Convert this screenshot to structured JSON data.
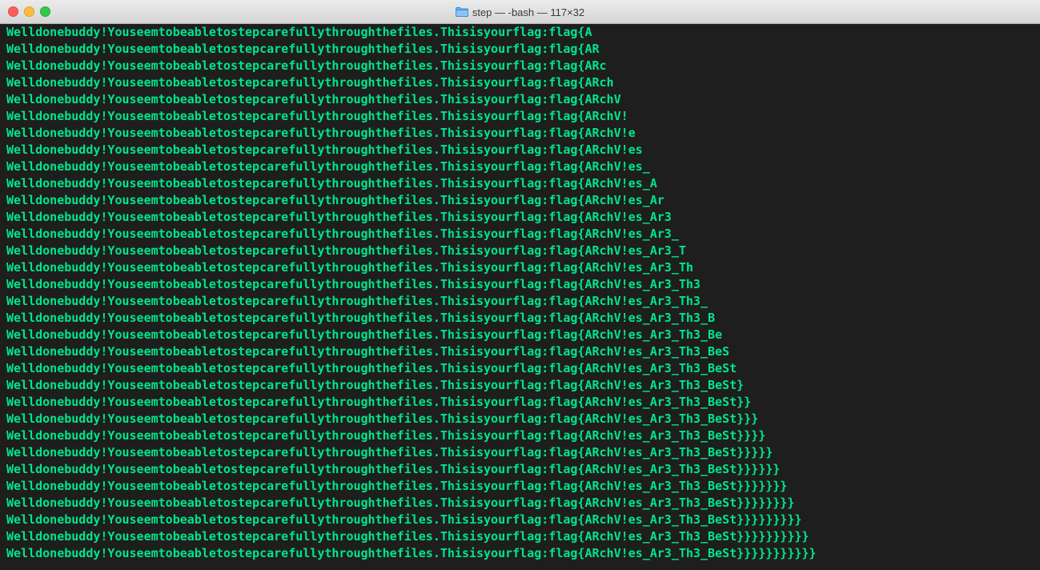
{
  "window": {
    "title": "step — -bash — 117×32"
  },
  "colors": {
    "terminal_background": "#1e1e1e",
    "terminal_text": "#00e58c",
    "close": "#fc605c",
    "minimize": "#fdbc40",
    "maximize": "#34c84a"
  },
  "icons": {
    "title": "folder-icon"
  },
  "terminal": {
    "lines": [
      "Welldonebuddy!Youseemtobeabletostepcarefullythroughthefiles.Thisisyourflag:flag{A",
      "Welldonebuddy!Youseemtobeabletostepcarefullythroughthefiles.Thisisyourflag:flag{AR",
      "Welldonebuddy!Youseemtobeabletostepcarefullythroughthefiles.Thisisyourflag:flag{ARc",
      "Welldonebuddy!Youseemtobeabletostepcarefullythroughthefiles.Thisisyourflag:flag{ARch",
      "Welldonebuddy!Youseemtobeabletostepcarefullythroughthefiles.Thisisyourflag:flag{ARchV",
      "Welldonebuddy!Youseemtobeabletostepcarefullythroughthefiles.Thisisyourflag:flag{ARchV!",
      "Welldonebuddy!Youseemtobeabletostepcarefullythroughthefiles.Thisisyourflag:flag{ARchV!e",
      "Welldonebuddy!Youseemtobeabletostepcarefullythroughthefiles.Thisisyourflag:flag{ARchV!es",
      "Welldonebuddy!Youseemtobeabletostepcarefullythroughthefiles.Thisisyourflag:flag{ARchV!es_",
      "Welldonebuddy!Youseemtobeabletostepcarefullythroughthefiles.Thisisyourflag:flag{ARchV!es_A",
      "Welldonebuddy!Youseemtobeabletostepcarefullythroughthefiles.Thisisyourflag:flag{ARchV!es_Ar",
      "Welldonebuddy!Youseemtobeabletostepcarefullythroughthefiles.Thisisyourflag:flag{ARchV!es_Ar3",
      "Welldonebuddy!Youseemtobeabletostepcarefullythroughthefiles.Thisisyourflag:flag{ARchV!es_Ar3_",
      "Welldonebuddy!Youseemtobeabletostepcarefullythroughthefiles.Thisisyourflag:flag{ARchV!es_Ar3_T",
      "Welldonebuddy!Youseemtobeabletostepcarefullythroughthefiles.Thisisyourflag:flag{ARchV!es_Ar3_Th",
      "Welldonebuddy!Youseemtobeabletostepcarefullythroughthefiles.Thisisyourflag:flag{ARchV!es_Ar3_Th3",
      "Welldonebuddy!Youseemtobeabletostepcarefullythroughthefiles.Thisisyourflag:flag{ARchV!es_Ar3_Th3_",
      "Welldonebuddy!Youseemtobeabletostepcarefullythroughthefiles.Thisisyourflag:flag{ARchV!es_Ar3_Th3_B",
      "Welldonebuddy!Youseemtobeabletostepcarefullythroughthefiles.Thisisyourflag:flag{ARchV!es_Ar3_Th3_Be",
      "Welldonebuddy!Youseemtobeabletostepcarefullythroughthefiles.Thisisyourflag:flag{ARchV!es_Ar3_Th3_BeS",
      "Welldonebuddy!Youseemtobeabletostepcarefullythroughthefiles.Thisisyourflag:flag{ARchV!es_Ar3_Th3_BeSt",
      "Welldonebuddy!Youseemtobeabletostepcarefullythroughthefiles.Thisisyourflag:flag{ARchV!es_Ar3_Th3_BeSt}",
      "Welldonebuddy!Youseemtobeabletostepcarefullythroughthefiles.Thisisyourflag:flag{ARchV!es_Ar3_Th3_BeSt}}",
      "Welldonebuddy!Youseemtobeabletostepcarefullythroughthefiles.Thisisyourflag:flag{ARchV!es_Ar3_Th3_BeSt}}}",
      "Welldonebuddy!Youseemtobeabletostepcarefullythroughthefiles.Thisisyourflag:flag{ARchV!es_Ar3_Th3_BeSt}}}}",
      "Welldonebuddy!Youseemtobeabletostepcarefullythroughthefiles.Thisisyourflag:flag{ARchV!es_Ar3_Th3_BeSt}}}}}",
      "Welldonebuddy!Youseemtobeabletostepcarefullythroughthefiles.Thisisyourflag:flag{ARchV!es_Ar3_Th3_BeSt}}}}}}",
      "Welldonebuddy!Youseemtobeabletostepcarefullythroughthefiles.Thisisyourflag:flag{ARchV!es_Ar3_Th3_BeSt}}}}}}}",
      "Welldonebuddy!Youseemtobeabletostepcarefullythroughthefiles.Thisisyourflag:flag{ARchV!es_Ar3_Th3_BeSt}}}}}}}}",
      "Welldonebuddy!Youseemtobeabletostepcarefullythroughthefiles.Thisisyourflag:flag{ARchV!es_Ar3_Th3_BeSt}}}}}}}}}",
      "Welldonebuddy!Youseemtobeabletostepcarefullythroughthefiles.Thisisyourflag:flag{ARchV!es_Ar3_Th3_BeSt}}}}}}}}}}",
      "Welldonebuddy!Youseemtobeabletostepcarefullythroughthefiles.Thisisyourflag:flag{ARchV!es_Ar3_Th3_BeSt}}}}}}}}}}}"
    ]
  }
}
